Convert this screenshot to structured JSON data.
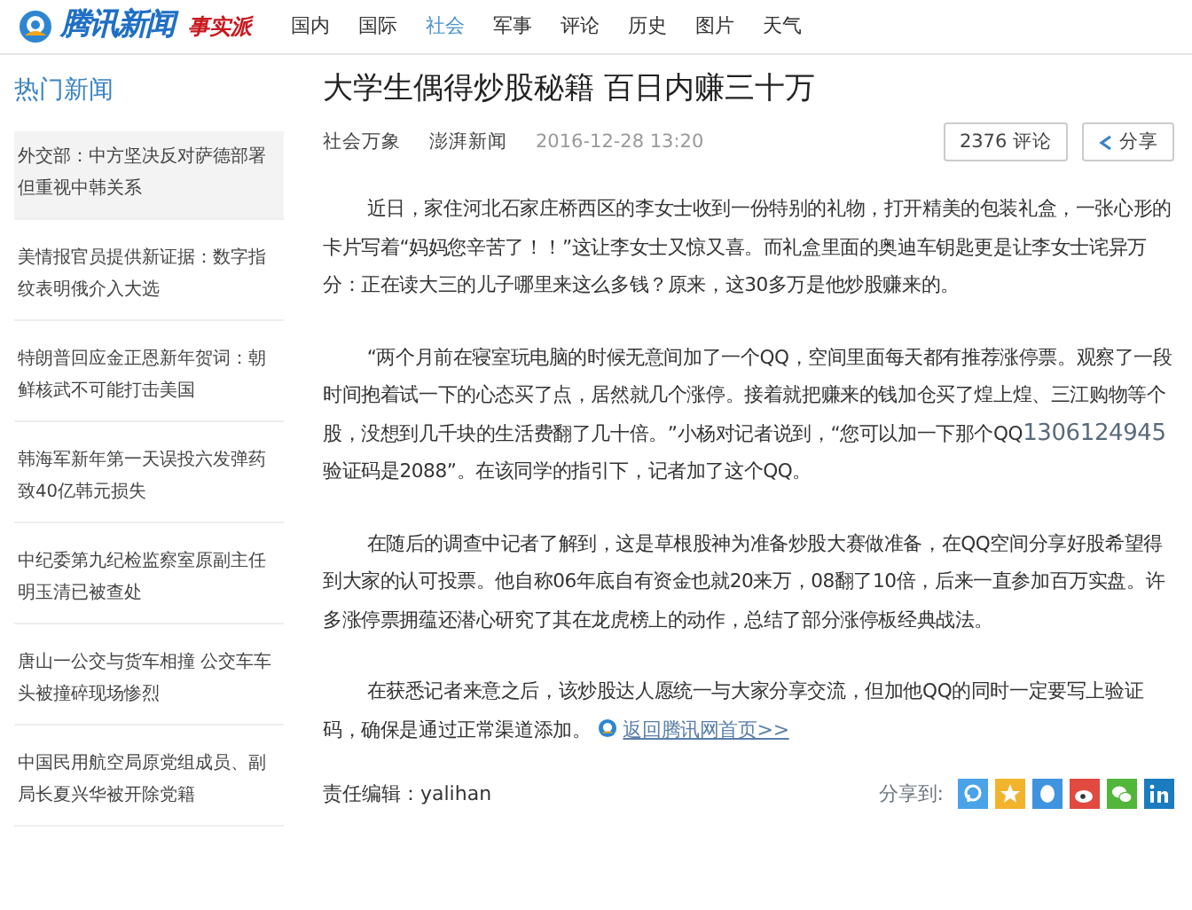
{
  "header": {
    "logo_text": "腾讯新闻",
    "logo_tag": "事实派",
    "nav": [
      {
        "label": "国内",
        "selected": false
      },
      {
        "label": "国际",
        "selected": false
      },
      {
        "label": "社会",
        "selected": true
      },
      {
        "label": "军事",
        "selected": false
      },
      {
        "label": "评论",
        "selected": false
      },
      {
        "label": "历史",
        "selected": false
      },
      {
        "label": "图片",
        "selected": false
      },
      {
        "label": "天气",
        "selected": false
      }
    ]
  },
  "sidebar": {
    "title": "热门新闻",
    "items": [
      {
        "text": "外交部：中方坚决反对萨德部署但重视中韩关系",
        "highlighted": true
      },
      {
        "text": "美情报官员提供新证据：数字指纹表明俄介入大选",
        "highlighted": false
      },
      {
        "text": "特朗普回应金正恩新年贺词：朝鲜核武不可能打击美国",
        "highlighted": false
      },
      {
        "text": "韩海军新年第一天误投六发弹药致40亿韩元损失",
        "highlighted": false
      },
      {
        "text": "中纪委第九纪检监察室原副主任明玉清已被查处",
        "highlighted": false
      },
      {
        "text": "唐山一公交与货车相撞 公交车车头被撞碎现场惨烈",
        "highlighted": false
      },
      {
        "text": "中国民用航空局原党组成员、副局长夏兴华被开除党籍",
        "highlighted": false
      }
    ]
  },
  "article": {
    "title": "大学生偶得炒股秘籍 百日内赚三十万",
    "meta": {
      "category": "社会万象",
      "source": "澎湃新闻",
      "time": "2016-12-28 13:20",
      "comments": "2376 评论",
      "share": "分享"
    },
    "paragraphs": [
      [
        {
          "kind": "text",
          "text": "近日，家住河北石家庄桥西区的李女士收到一份特别的礼物，打开精美的包装礼盒，一张心形的卡片写着“妈妈您辛苦了！！”这让李女士又惊又喜。而礼盒里面的奥迪车钥匙更是让李女士诧异万分：正在读大三的儿子哪里来这么多钱？原来，这30多万是他炒股赚来的。"
        }
      ],
      [
        {
          "kind": "text",
          "text": "“两个月前在寝室玩电脑的时候无意间加了一个QQ，空间里面每天都有推荐涨停票。观察了一段时间抱着试一下的心态买了点，居然就几个涨停。接着就把赚来的钱加仓买了煌上煌、三江购物等个股，没想到几千块的生活费翻了几十倍。”小杨对记者说到，“您可以加一下那个QQ"
        },
        {
          "kind": "number",
          "text": "1306124945"
        },
        {
          "kind": "text",
          "text": " 验证码是2088”。在该同学的指引下，记者加了这个QQ。"
        }
      ],
      [
        {
          "kind": "text",
          "text": "在随后的调查中记者了解到，这是草根股神为准备炒股大赛做准备，在QQ空间分享好股希望得到大家的认可投票。他自称06年底自有资金也就20来万，08翻了10倍，后来一直参加百万实盘。许多涨停票拥蕴还潜心研究了其在龙虎榜上的动作，总结了部分涨停板经典战法。"
        }
      ],
      [
        {
          "kind": "text",
          "text": "在获悉记者来意之后，该炒股达人愿统一与大家分享交流，但加他QQ的同时一定要写上验证码，确保是通过正常渠道添加。"
        },
        {
          "kind": "link",
          "text": "返回腾讯网首页>>"
        }
      ]
    ],
    "editor": "责任编辑：yalihan",
    "share_label": "分享到:",
    "share_icons": [
      {
        "kind": "pengyou",
        "color": "#4aa3e8"
      },
      {
        "kind": "qzone",
        "color": "#f2b42c"
      },
      {
        "kind": "qq",
        "color": "#3f93df"
      },
      {
        "kind": "weibo",
        "color": "#e2493f"
      },
      {
        "kind": "wechat",
        "color": "#52b63a"
      },
      {
        "kind": "linkedin",
        "color": "#1a7bbf"
      }
    ]
  }
}
